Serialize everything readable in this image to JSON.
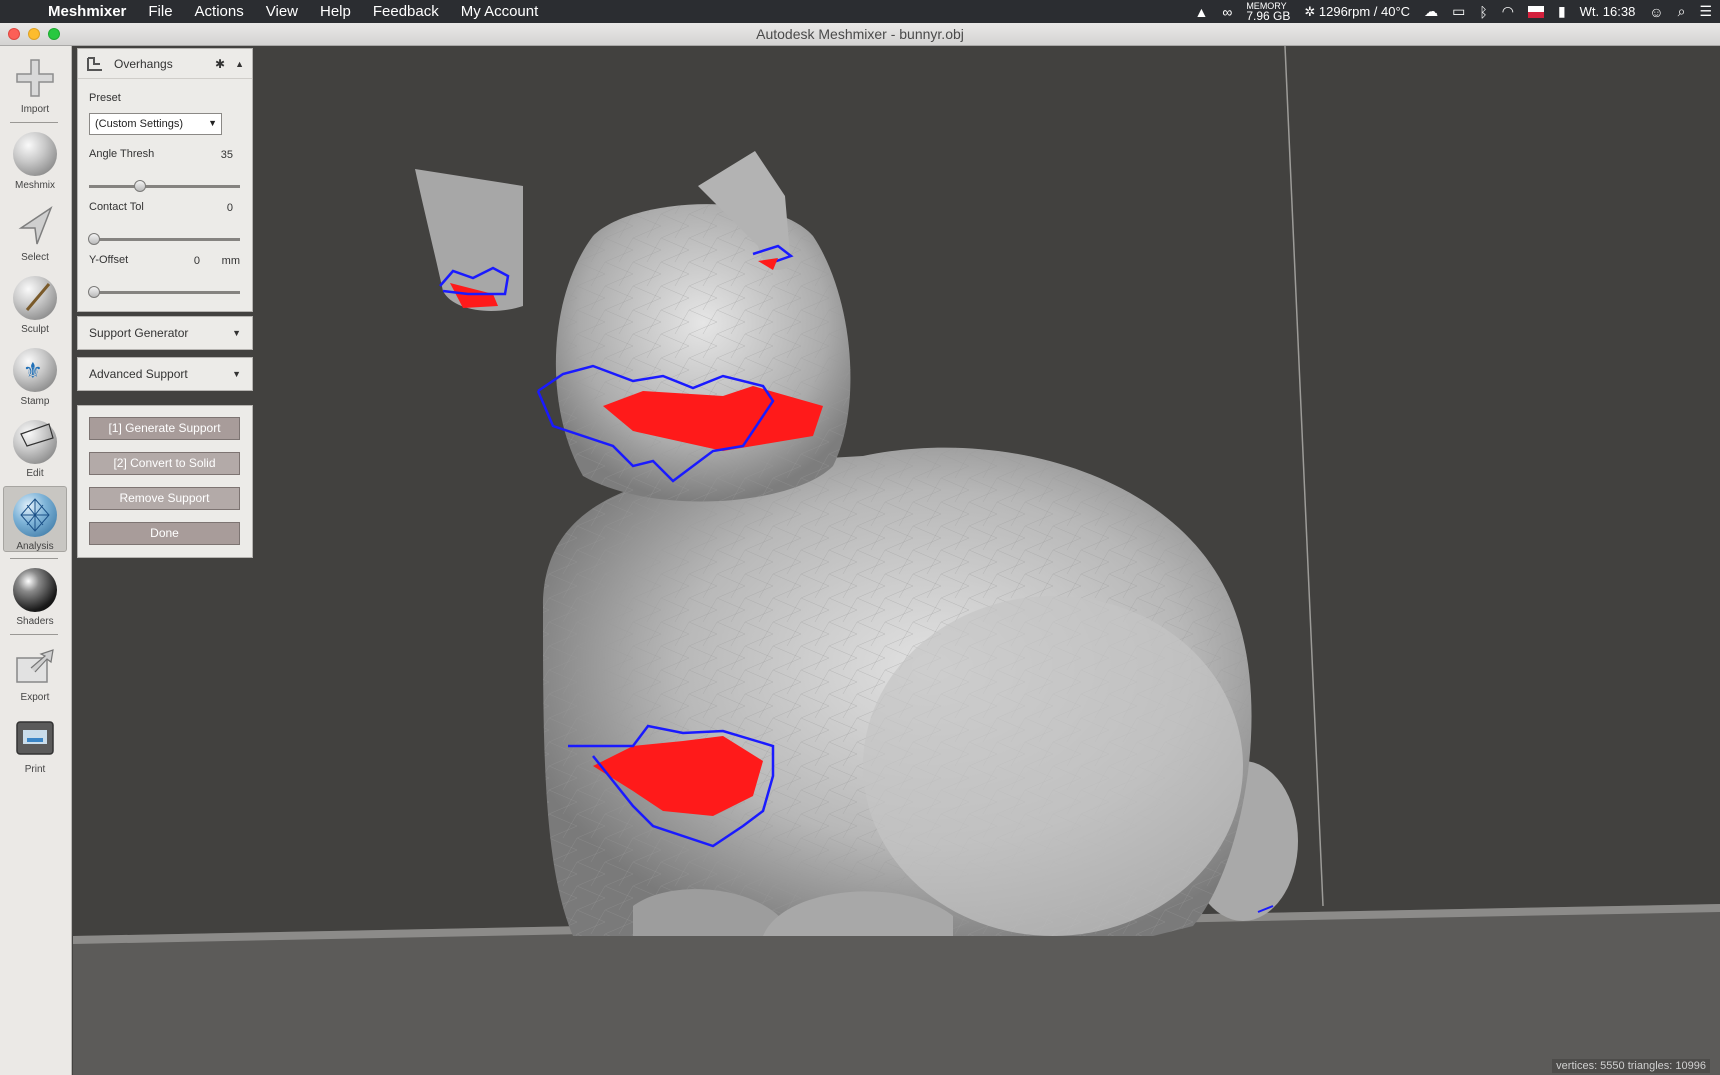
{
  "menubar": {
    "app_name": "Meshmixer",
    "items": [
      "File",
      "Actions",
      "View",
      "Help",
      "Feedback",
      "My Account"
    ],
    "memory_label": "MEMORY",
    "memory_value": "7.96 GB",
    "fan_temp": "1296rpm / 40°C",
    "clock": "Wt. 16:38"
  },
  "window": {
    "title": "Autodesk Meshmixer - bunnyr.obj"
  },
  "toolbar": {
    "tools": [
      {
        "label": "Import",
        "icon": "plus-icon"
      },
      {
        "label": "Meshmix",
        "icon": "meshmix-sphere-icon"
      },
      {
        "label": "Select",
        "icon": "select-arrow-icon"
      },
      {
        "label": "Sculpt",
        "icon": "sculpt-brush-icon"
      },
      {
        "label": "Stamp",
        "icon": "stamp-icon"
      },
      {
        "label": "Edit",
        "icon": "edit-sphere-icon"
      },
      {
        "label": "Analysis",
        "icon": "analysis-sphere-icon"
      },
      {
        "label": "Shaders",
        "icon": "shader-sphere-icon"
      },
      {
        "label": "Export",
        "icon": "export-icon"
      },
      {
        "label": "Print",
        "icon": "printer-icon"
      }
    ],
    "active": "Analysis"
  },
  "overhangs": {
    "title": "Overhangs",
    "preset_label": "Preset",
    "preset_value": "(Custom Settings)",
    "angle_label": "Angle Thresh",
    "angle_value": "35",
    "angle_fraction": 0.33,
    "contact_label": "Contact Tol",
    "contact_value": "0",
    "contact_fraction": 0,
    "yoffset_label": "Y-Offset",
    "yoffset_value": "0",
    "yoffset_unit": "mm",
    "yoffset_fraction": 0
  },
  "support_generator": {
    "title": "Support Generator"
  },
  "advanced_support": {
    "title": "Advanced Support"
  },
  "actions": {
    "generate": "[1] Generate Support",
    "convert": "[2] Convert to Solid",
    "remove": "Remove Support",
    "done": "Done"
  },
  "status": {
    "text": "vertices: 5550 triangles: 10996"
  },
  "colors": {
    "overhang": "#ff1a1a",
    "outline": "#1a1aff",
    "mesh": "#bdbdbd"
  }
}
